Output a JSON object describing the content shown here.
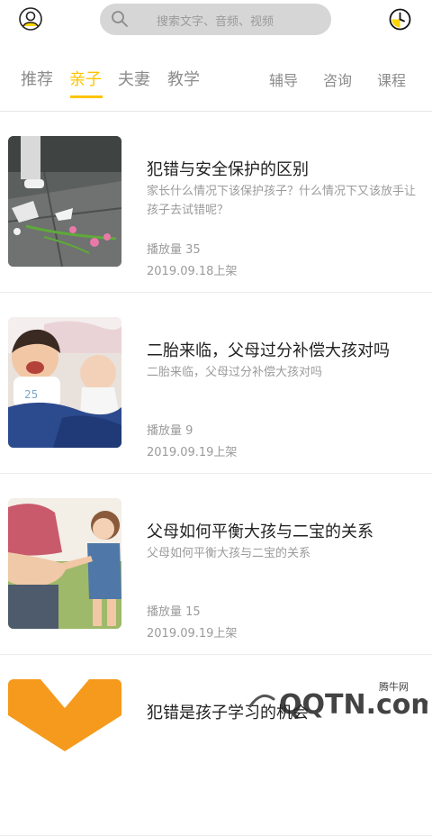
{
  "header": {
    "search_placeholder": "搜索文字、音频、视频"
  },
  "tabs": {
    "left": [
      "推荐",
      "亲子",
      "夫妻",
      "教学"
    ],
    "right": [
      "辅导",
      "咨询",
      "课程"
    ],
    "active": "亲子",
    "accent_color": "#ffc400"
  },
  "items": [
    {
      "title": "犯错与安全保护的区别",
      "desc": "家长什么情况下该保护孩子？什么情况下又该放手让孩子去试错呢？",
      "plays": "播放量 35",
      "date": "2019.09.18上架"
    },
    {
      "title": "二胎来临，父母过分补偿大孩对吗",
      "desc": "二胎来临，父母过分补偿大孩对吗",
      "plays": "播放量 9",
      "date": "2019.09.19上架"
    },
    {
      "title": "父母如何平衡大孩与二宝的关系",
      "desc": "父母如何平衡大孩与二宝的关系",
      "plays": "播放量 15",
      "date": "2019.09.19上架"
    },
    {
      "title": "犯错是孩子学习的机会",
      "desc": "",
      "plays": "",
      "date": ""
    }
  ],
  "watermark": {
    "label": "腾牛网",
    "text": "QQTN.com"
  }
}
